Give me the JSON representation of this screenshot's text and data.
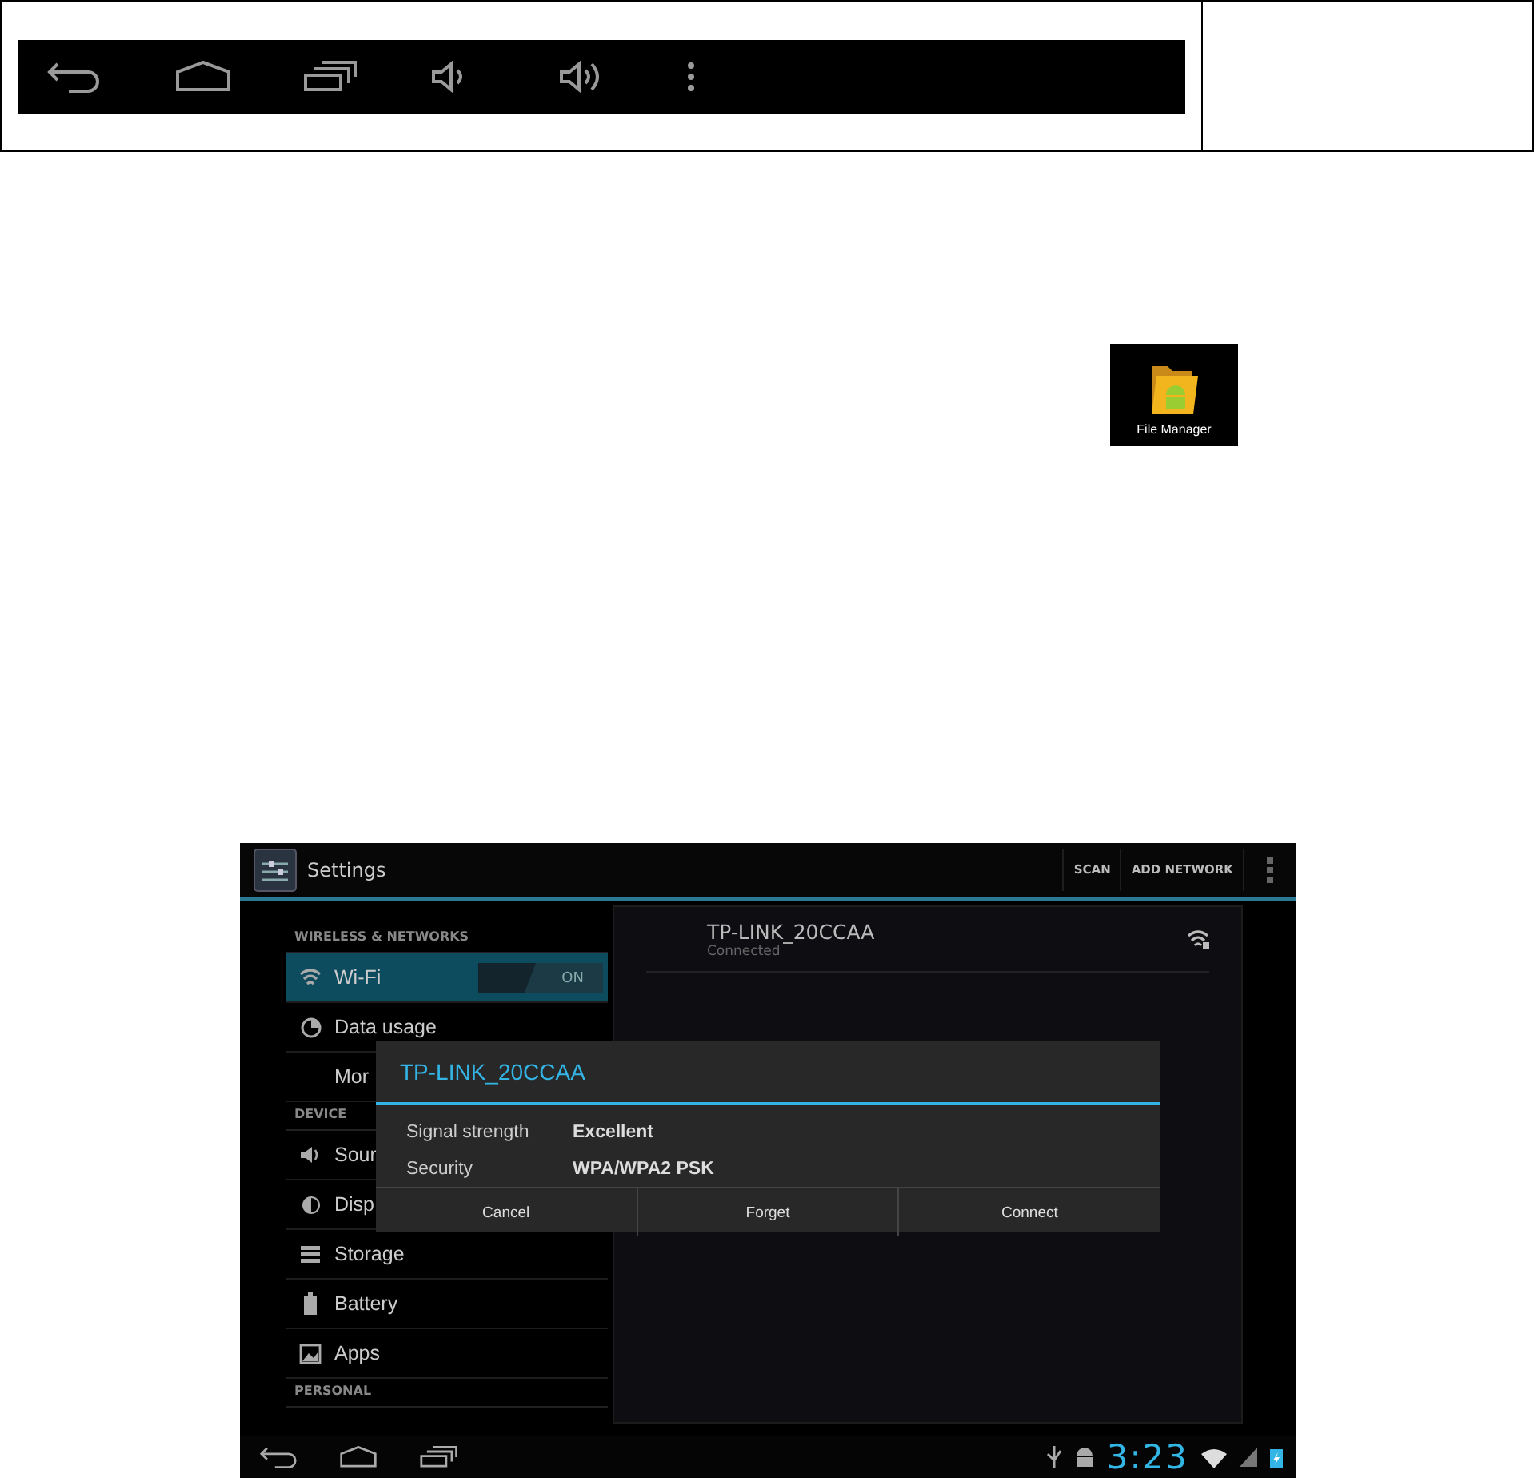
{
  "key_table": {
    "nav_keys": [
      {
        "kind": "back"
      },
      {
        "kind": "home"
      },
      {
        "kind": "recents"
      },
      {
        "kind": "volume_down"
      },
      {
        "kind": "volume_up"
      },
      {
        "kind": "menu"
      }
    ]
  },
  "app_icon": {
    "label": "File Manager"
  },
  "tablet": {
    "action_bar": {
      "title": "Settings",
      "actions": [
        "SCAN",
        "ADD NETWORK"
      ]
    },
    "sidebar": [
      {
        "kind": "header",
        "label": "WIRELESS & NETWORKS"
      },
      {
        "kind": "wifi",
        "label": "Wi-Fi",
        "selected": true,
        "toggle": {
          "label": "ON",
          "on": true
        }
      },
      {
        "kind": "data",
        "label": "Data usage",
        "selected": false
      },
      {
        "kind": "plain",
        "label": "Mor",
        "selected": false
      },
      {
        "kind": "header",
        "label": "DEVICE"
      },
      {
        "kind": "sound",
        "label": "Sour",
        "selected": false
      },
      {
        "kind": "display",
        "label": "Disp",
        "selected": false
      },
      {
        "kind": "storage",
        "label": "Storage",
        "selected": false
      },
      {
        "kind": "battery",
        "label": "Battery",
        "selected": false
      },
      {
        "kind": "apps",
        "label": "Apps",
        "selected": false
      },
      {
        "kind": "header",
        "label": "PERSONAL"
      }
    ],
    "networks": [
      {
        "name": "TP-LINK_20CCAA",
        "status": "Connected"
      }
    ],
    "dialog": {
      "title": "TP-LINK_20CCAA",
      "rows": [
        {
          "label": "Signal strength",
          "value": "Excellent"
        },
        {
          "label": "Security",
          "value": "WPA/WPA2 PSK"
        }
      ],
      "buttons": [
        "Cancel",
        "Forget",
        "Connect"
      ]
    },
    "nav_bar": {
      "keys": [
        {
          "kind": "back"
        },
        {
          "kind": "home"
        },
        {
          "kind": "recents"
        }
      ],
      "clock": "3:23"
    }
  }
}
